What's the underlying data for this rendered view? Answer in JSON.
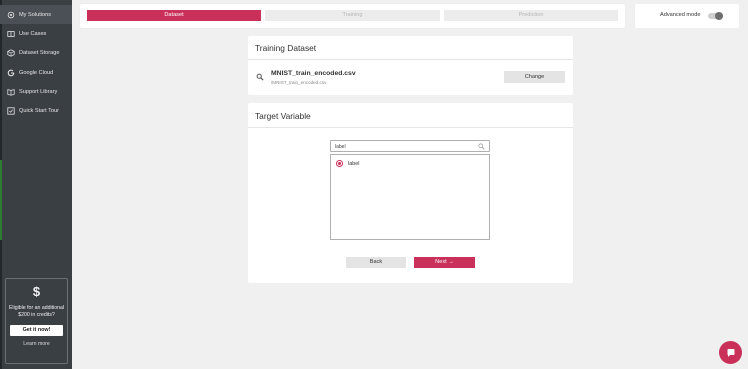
{
  "sidebar": {
    "items": [
      {
        "label": "My Solutions",
        "icon": "gear-icon"
      },
      {
        "label": "Use Cases",
        "icon": "book-icon"
      },
      {
        "label": "Dataset Storage",
        "icon": "box-icon"
      },
      {
        "label": "Google Cloud",
        "icon": "google-icon"
      },
      {
        "label": "Support Library",
        "icon": "open-book-icon"
      },
      {
        "label": "Quick Start Tour",
        "icon": "tour-icon"
      }
    ],
    "promo": {
      "symbol": "$",
      "message": "Eligible for an additional $200 in credits?",
      "cta": "Get it now!",
      "link": "Learn more"
    }
  },
  "stepper": {
    "steps": [
      {
        "label": "Dataset",
        "state": "active"
      },
      {
        "label": "Training",
        "state": "inactive"
      },
      {
        "label": "Prediction",
        "state": "inactive"
      }
    ]
  },
  "advanced": {
    "label": "Advanced mode",
    "enabled": false
  },
  "training_dataset": {
    "title": "Training Dataset",
    "file_name": "MNIST_train_encoded.csv",
    "file_sub": "/MNIST_train_encoded.csv",
    "change_label": "Change"
  },
  "target_variable": {
    "title": "Target Variable",
    "search_value": "label",
    "options": [
      {
        "label": "label",
        "selected": true
      }
    ]
  },
  "actions": {
    "back": "Back",
    "next": "Next →"
  },
  "colors": {
    "accent": "#c9305a",
    "sidebar": "#3a3f44",
    "background": "#f0f0f0"
  }
}
